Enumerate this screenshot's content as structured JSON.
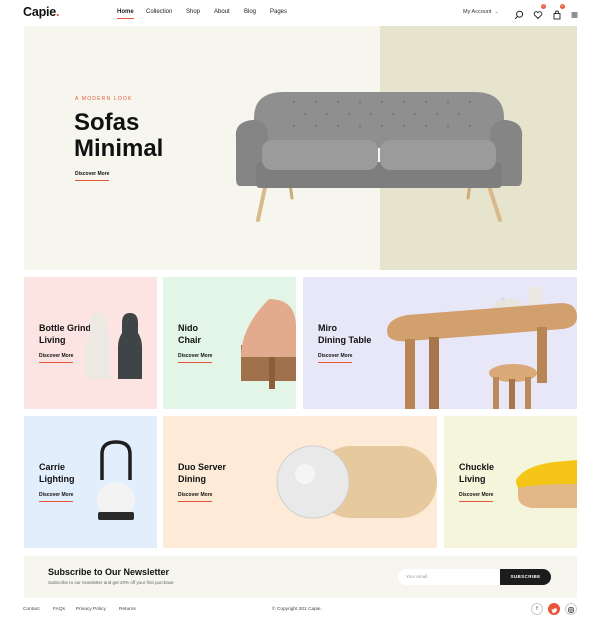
{
  "header": {
    "logo": "Capie",
    "logo_dot": ".",
    "nav": [
      "Home",
      "Collection",
      "Shop",
      "About",
      "Blog",
      "Pages"
    ],
    "account_label": "My Account",
    "icons": [
      "search-icon",
      "heart-icon",
      "bag-icon",
      "menu-icon"
    ],
    "wishlist_count": "0",
    "cart_count": "0"
  },
  "hero": {
    "tagline": "A MODERN LOOK",
    "title_line1": "Sofas",
    "title_line2": "Minimal",
    "cta": "Discover More"
  },
  "cards": [
    {
      "title1": "Bottle Grinder",
      "title2": "Living",
      "cta": "Discover More",
      "bg": "#fbe4e1"
    },
    {
      "title1": "Nido",
      "title2": "Chair",
      "cta": "Discover More",
      "bg": "#e3f5e6"
    },
    {
      "title1": "Miro",
      "title2": "Dining Table",
      "cta": "Discover More",
      "bg": "#e7e7f8"
    },
    {
      "title1": "Carrie",
      "title2": "Lighting",
      "cta": "Discover More",
      "bg": "#e3eefc"
    },
    {
      "title1": "Duo Server",
      "title2": "Dining",
      "cta": "Discover More",
      "bg": "#fdebd8"
    },
    {
      "title1": "Chuckle",
      "title2": "Living",
      "cta": "Discover More",
      "bg": "#f5f5dc"
    }
  ],
  "newsletter": {
    "title": "Subscribe to Our Newsletter",
    "subtitle": "Subscribe to our newsletter and get 20% off your first purchase",
    "placeholder": "Your email",
    "button": "SUBSCRIBE"
  },
  "footer": {
    "links": [
      "Contact",
      "FAQs",
      "Privacy Policy",
      "Returns"
    ],
    "copyright": "© Copyright 201 Capie.",
    "social": [
      "f",
      "t",
      "ig"
    ]
  },
  "colors": {
    "accent": "#e8553a",
    "dark": "#1c1c1c"
  }
}
